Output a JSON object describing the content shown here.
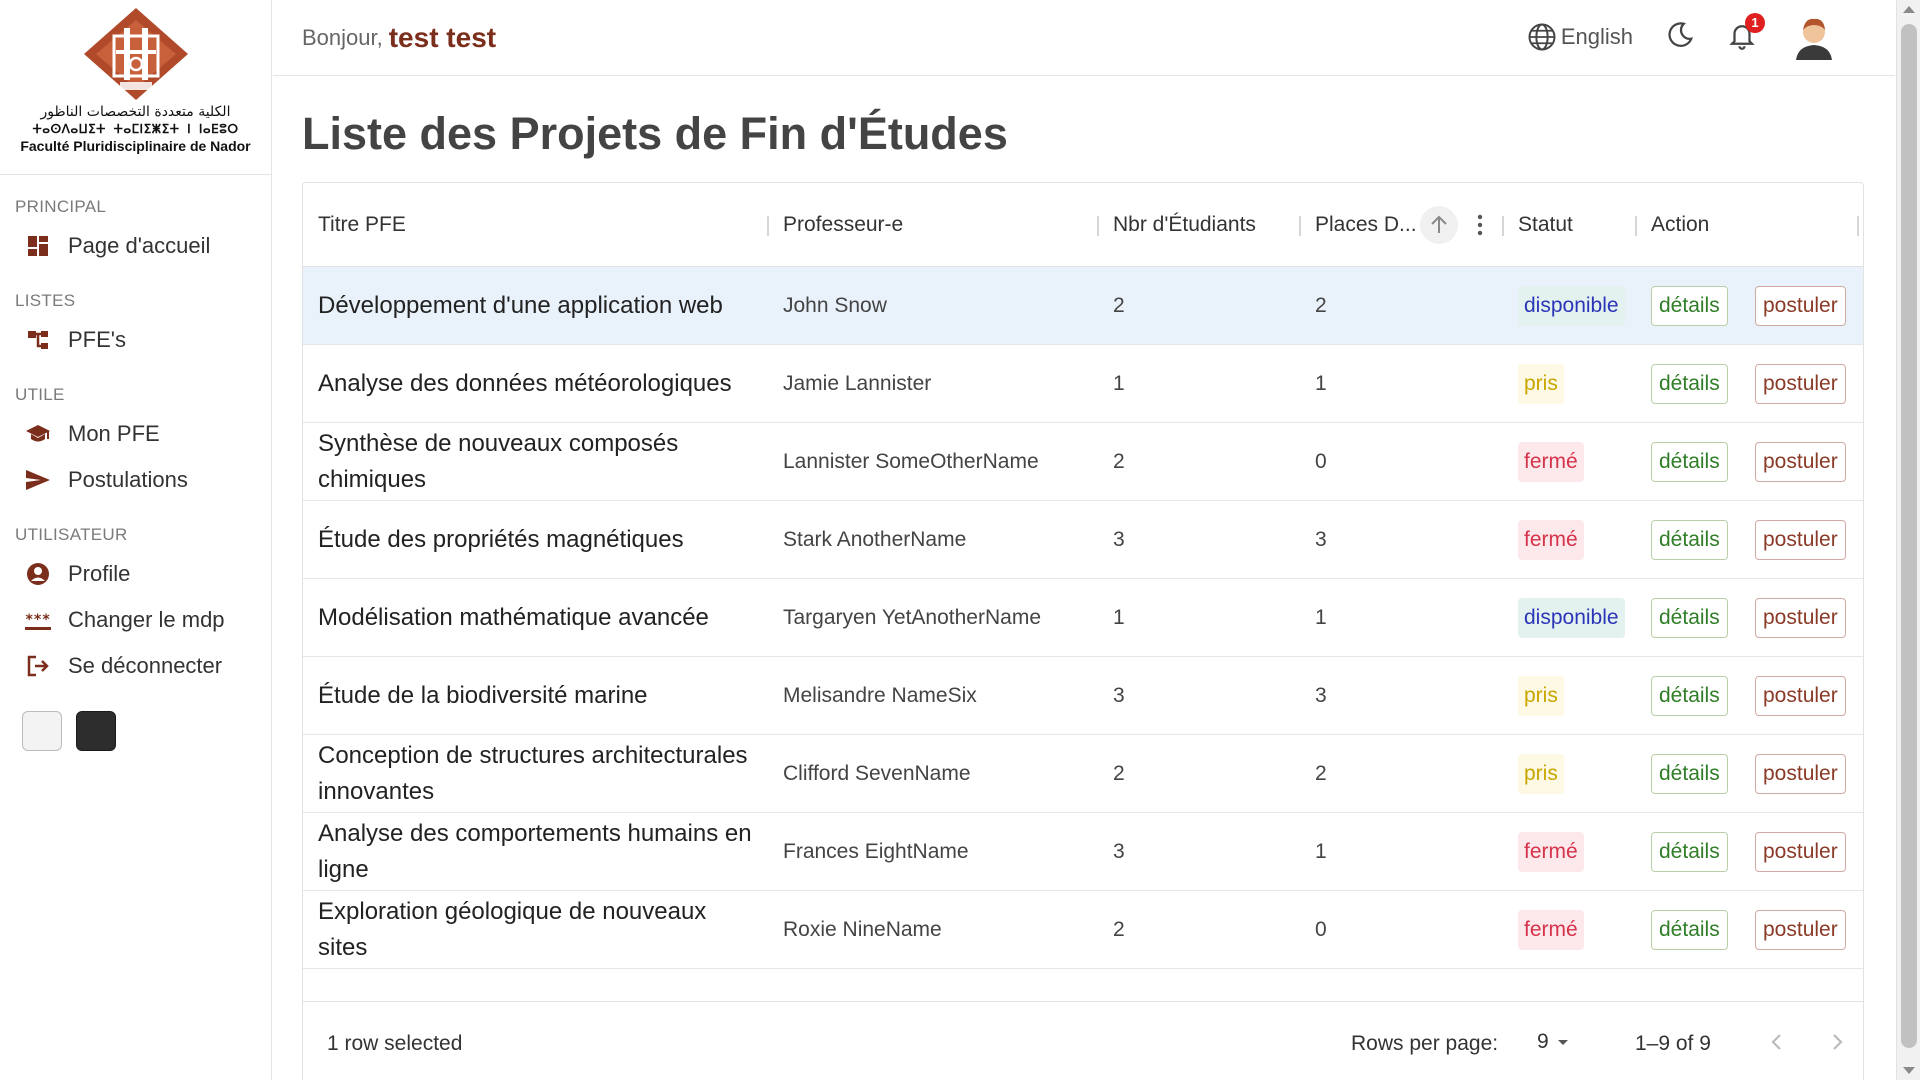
{
  "logo": {
    "arabic": "الكلية متعددة التخصصات الناظور",
    "tifinagh": "ⵜⴰⵙⴷⴰⵡⵉⵜ ⵜⴰⵎⵏⵉⵥⵉⵜ ⵏ ⵏⴰⴹⵓⵔ",
    "french": "Faculté Pluridisciplinaire de Nador"
  },
  "sidebar": {
    "sections": [
      {
        "title": "PRINCIPAL",
        "items": [
          {
            "label": "Page d'accueil",
            "icon": "dashboard-icon"
          }
        ]
      },
      {
        "title": "LISTES",
        "items": [
          {
            "label": "PFE's",
            "icon": "tree-icon"
          }
        ]
      },
      {
        "title": "UTILE",
        "items": [
          {
            "label": "Mon PFE",
            "icon": "graduation-cap-icon"
          },
          {
            "label": "Postulations",
            "icon": "send-icon"
          }
        ]
      },
      {
        "title": "UTILISATEUR",
        "items": [
          {
            "label": "Profile",
            "icon": "account-circle-icon"
          },
          {
            "label": "Changer le mdp",
            "icon": "password-icon"
          },
          {
            "label": "Se déconnecter",
            "icon": "logout-icon"
          }
        ]
      }
    ]
  },
  "header": {
    "greeting": "Bonjour,",
    "username": "test test",
    "language": "English",
    "notification_count": "1"
  },
  "page": {
    "title": "Liste des Projets de Fin d'Études"
  },
  "table": {
    "columns": {
      "titre": "Titre PFE",
      "professeur": "Professeur-e",
      "nbr": "Nbr d'Étudiants",
      "places": "Places D...",
      "statut": "Statut",
      "action": "Action"
    },
    "details_label": "détails",
    "postuler_label": "postuler",
    "rows": [
      {
        "title": "Développement d'une application web",
        "prof": "John Snow",
        "nbr": "2",
        "places": "2",
        "status": "disponible",
        "selected": true
      },
      {
        "title": "Analyse des données météorologiques",
        "prof": "Jamie Lannister",
        "nbr": "1",
        "places": "1",
        "status": "pris"
      },
      {
        "title": "Synthèse de nouveaux composés chimiques",
        "prof": "Lannister SomeOtherName",
        "nbr": "2",
        "places": "0",
        "status": "fermé"
      },
      {
        "title": "Étude des propriétés magnétiques",
        "prof": "Stark AnotherName",
        "nbr": "3",
        "places": "3",
        "status": "fermé"
      },
      {
        "title": "Modélisation mathématique avancée",
        "prof": "Targaryen YetAnotherName",
        "nbr": "1",
        "places": "1",
        "status": "disponible"
      },
      {
        "title": "Étude de la biodiversité marine",
        "prof": "Melisandre NameSix",
        "nbr": "3",
        "places": "3",
        "status": "pris"
      },
      {
        "title": "Conception de structures architecturales innovantes",
        "prof": "Clifford SevenName",
        "nbr": "2",
        "places": "2",
        "status": "pris"
      },
      {
        "title": "Analyse des comportements humains en ligne",
        "prof": "Frances EightName",
        "nbr": "3",
        "places": "1",
        "status": "fermé"
      },
      {
        "title": "Exploration géologique de nouveaux sites",
        "prof": "Roxie NineName",
        "nbr": "2",
        "places": "0",
        "status": "fermé"
      }
    ],
    "footer": {
      "selected": "1 row selected",
      "rows_per_page_label": "Rows per page:",
      "rows_per_page": "9",
      "range": "1–9 of 9"
    }
  },
  "colors": {
    "brand": "#7a2e1b",
    "disponible": "#2b35b8",
    "pris": "#c8a600",
    "ferme": "#d5334a",
    "details": "#2f7d26",
    "postuler": "#8a3a26"
  }
}
